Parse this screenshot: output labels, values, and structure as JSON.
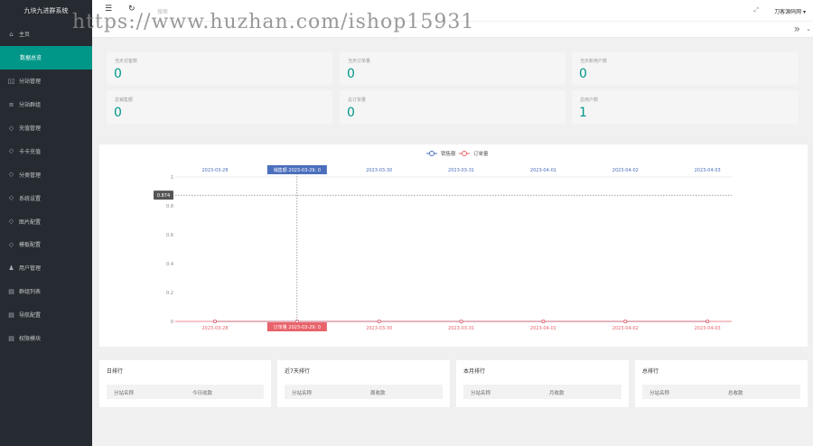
{
  "watermark": "https://www.huzhan.com/ishop15931",
  "sidebar": {
    "brand": "九块九进群系统",
    "home": "主页",
    "items": [
      {
        "label": "数据总览",
        "icon": ""
      },
      {
        "label": "分站管理",
        "icon": "▯▯"
      },
      {
        "label": "分站群组",
        "icon": "≡"
      },
      {
        "label": "充值管理",
        "icon": "◇"
      },
      {
        "label": "卡卡充值",
        "icon": "◇"
      },
      {
        "label": "分类管理",
        "icon": "◇"
      },
      {
        "label": "系统设置",
        "icon": "◇"
      },
      {
        "label": "图片配置",
        "icon": "◇"
      },
      {
        "label": "模板配置",
        "icon": "◇"
      },
      {
        "label": "用户管理",
        "icon": "♟"
      },
      {
        "label": "群组列表",
        "icon": "▤"
      },
      {
        "label": "导航配置",
        "icon": "▤"
      },
      {
        "label": "权限模块",
        "icon": "▤"
      }
    ]
  },
  "header": {
    "search": "搜索",
    "user": "刀客源码网",
    "menu_icon": "hamburger-icon",
    "refresh_icon": "refresh-icon"
  },
  "stats": [
    {
      "label": "当天访客数",
      "value": "0"
    },
    {
      "label": "当天订单量",
      "value": "0"
    },
    {
      "label": "当天新用户数",
      "value": "0"
    },
    {
      "label": "总销售额",
      "value": "0"
    },
    {
      "label": "总订单量",
      "value": "0"
    },
    {
      "label": "总用户数",
      "value": "1"
    }
  ],
  "chart_data": {
    "type": "line",
    "x": [
      "2023-03-28",
      "2023-03-29",
      "2023-03-30",
      "2023-03-31",
      "2023-04-01",
      "2023-04-02",
      "2023-04-03"
    ],
    "series": [
      {
        "name": "销售额",
        "values": [
          0,
          0,
          0,
          0,
          0,
          0,
          0
        ],
        "color": "#4b6fbd"
      },
      {
        "name": "订单量",
        "values": [
          0,
          0,
          0,
          0,
          0,
          0,
          0
        ],
        "color": "#e8636b"
      }
    ],
    "yticks": [
      "0",
      "0.2",
      "0.4",
      "0.6",
      "0.8",
      "1"
    ],
    "ylim": [
      0,
      1
    ],
    "legend": "top-center",
    "tooltip": {
      "y_readout": "0.874",
      "top_label": "销售额  2023-03-29: 0",
      "bottom_label": "订单量  2023-03-29: 0"
    }
  },
  "ranks": [
    {
      "title": "日排行",
      "col1": "分站名称",
      "col2": "今日收款"
    },
    {
      "title": "近7天排行",
      "col1": "分站名称",
      "col2": "周收款"
    },
    {
      "title": "本月排行",
      "col1": "分站名称",
      "col2": "月收款"
    },
    {
      "title": "总排行",
      "col1": "分站名称",
      "col2": "总收款"
    }
  ]
}
